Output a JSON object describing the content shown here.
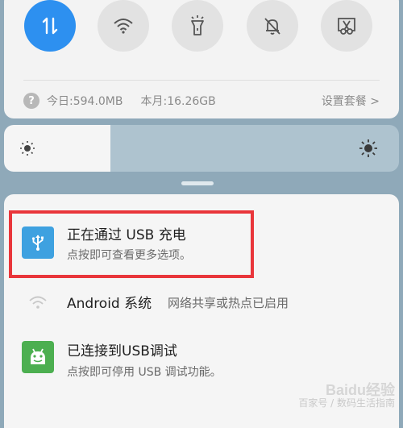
{
  "quick_settings": {
    "toggles": [
      {
        "name": "data-toggle",
        "icon": "data-arrows-icon",
        "active": true
      },
      {
        "name": "wifi-toggle",
        "icon": "wifi-icon",
        "active": false
      },
      {
        "name": "flashlight-toggle",
        "icon": "flashlight-icon",
        "active": false
      },
      {
        "name": "mute-toggle",
        "icon": "bell-off-icon",
        "active": false
      },
      {
        "name": "screenshot-toggle",
        "icon": "scissors-icon",
        "active": false
      }
    ],
    "data_usage": {
      "today": "今日:594.0MB",
      "month": "本月:16.26GB",
      "plan_link": "设置套餐 >"
    }
  },
  "brightness": {
    "level": 0.27
  },
  "notifications": [
    {
      "title": "正在通过 USB 充电",
      "text": "点按即可查看更多选项。",
      "icon": "usb-icon",
      "icon_color": "#3ea1e0"
    },
    {
      "title": "Android 系统",
      "text": "网络共享或热点已启用",
      "icon": "hotspot-icon"
    },
    {
      "title": "已连接到USB调试",
      "text": "点按即可停用 USB 调试功能。",
      "icon": "android-debug-icon",
      "icon_color": "#4caf50"
    }
  ],
  "watermark": {
    "logo": "Baidu经验",
    "line2": "百家号 / 数码生活指南"
  },
  "colors": {
    "accent": "#2d90f0",
    "highlight": "#e9363b"
  }
}
